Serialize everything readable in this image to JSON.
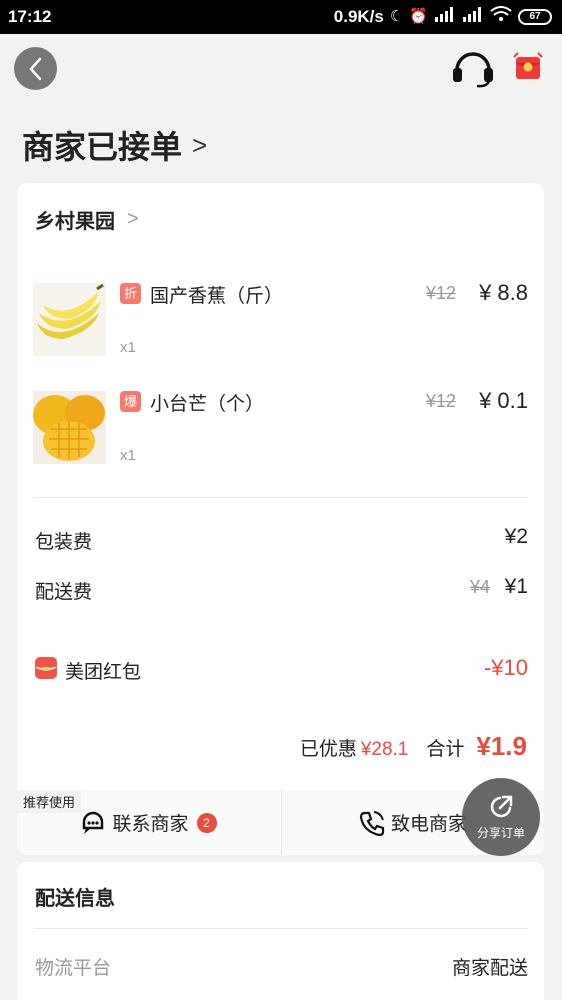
{
  "status_bar": {
    "time": "17:12",
    "network_speed": "0.9K/s",
    "battery": "67"
  },
  "header": {
    "order_status": "商家已接单"
  },
  "shop": {
    "name": "乡村果园"
  },
  "items": [
    {
      "badge": "折",
      "name": "国产香蕉（斤）",
      "quantity": "x1",
      "original_price": "¥12",
      "price": "¥ 8.8"
    },
    {
      "badge": "爆",
      "name": "小台芒（个）",
      "quantity": "x1",
      "original_price": "¥12",
      "price": "¥ 0.1"
    }
  ],
  "fees": {
    "packaging_label": "包装费",
    "packaging_value": "¥2",
    "delivery_label": "配送费",
    "delivery_original": "¥4",
    "delivery_value": "¥1"
  },
  "coupon": {
    "label": "美团红包",
    "value": "-¥10"
  },
  "summary": {
    "discount_label": "已优惠",
    "discount_value": "¥28.1",
    "total_label": "合计",
    "total_value": "¥1.9"
  },
  "actions": {
    "recommend_tag": "推荐使用",
    "contact_label": "联系商家",
    "contact_count": "2",
    "call_label": "致电商家"
  },
  "share": {
    "label": "分享订单"
  },
  "delivery": {
    "title": "配送信息",
    "platform_label": "物流平台",
    "platform_value": "商家配送"
  },
  "colors": {
    "accent_red": "#e84c3d",
    "badge_red": "#f47a6d",
    "background": "#f2f2f2"
  }
}
